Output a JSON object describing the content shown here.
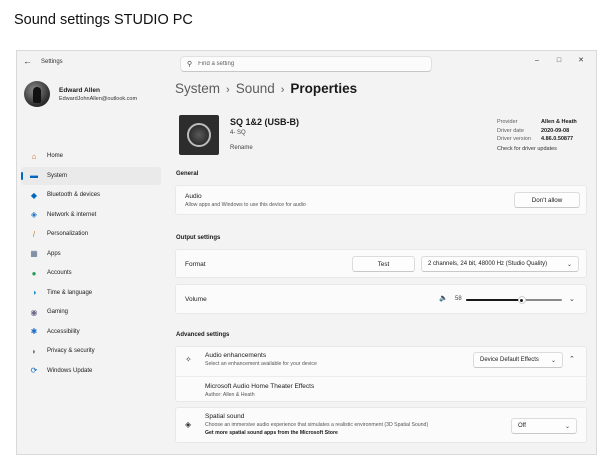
{
  "page_heading": "Sound settings STUDIO PC",
  "window": {
    "app_title": "Settings",
    "back_glyph": "←",
    "search_glyph": "⚲",
    "search_placeholder": "Find a setting",
    "controls": {
      "minimize": "–",
      "maximize": "□",
      "close": "✕"
    }
  },
  "profile": {
    "name": "Edward Allen",
    "email": "EdwardJohnAllen@outlook.com"
  },
  "nav": [
    {
      "label": "Home",
      "icon": "home-icon",
      "glyph": "⌂",
      "color": "#c96a2a",
      "active": false
    },
    {
      "label": "System",
      "icon": "monitor-icon",
      "glyph": "▬",
      "color": "#0067c0",
      "active": true
    },
    {
      "label": "Bluetooth & devices",
      "icon": "bluetooth-icon",
      "glyph": "◆",
      "color": "#0067c0",
      "active": false
    },
    {
      "label": "Network & internet",
      "icon": "wifi-icon",
      "glyph": "◈",
      "color": "#1a73c8",
      "active": false
    },
    {
      "label": "Personalization",
      "icon": "brush-icon",
      "glyph": "/",
      "color": "#c8782a",
      "active": false
    },
    {
      "label": "Apps",
      "icon": "apps-icon",
      "glyph": "▦",
      "color": "#5a6e8a",
      "active": false
    },
    {
      "label": "Accounts",
      "icon": "person-icon",
      "glyph": "●",
      "color": "#2a9a5a",
      "active": false
    },
    {
      "label": "Time & language",
      "icon": "globe-icon",
      "glyph": "◑",
      "color": "#1a8ac8",
      "active": false
    },
    {
      "label": "Gaming",
      "icon": "gamepad-icon",
      "glyph": "◉",
      "color": "#6a6a8a",
      "active": false
    },
    {
      "label": "Accessibility",
      "icon": "accessibility-icon",
      "glyph": "✱",
      "color": "#1a6ac8",
      "active": false
    },
    {
      "label": "Privacy & security",
      "icon": "shield-icon",
      "glyph": "◗",
      "color": "#6a6a7a",
      "active": false
    },
    {
      "label": "Windows Update",
      "icon": "update-icon",
      "glyph": "⟳",
      "color": "#0a6ac8",
      "active": false
    }
  ],
  "breadcrumb": {
    "part1": "System",
    "part2": "Sound",
    "current": "Properties",
    "sep": "›"
  },
  "device": {
    "name": "SQ 1&2 (USB-B)",
    "sub": "4- SQ",
    "rename": "Rename"
  },
  "driver": {
    "provider_label": "Provider",
    "provider": "Allen & Heath",
    "date_label": "Driver date",
    "date": "2020-09-08",
    "version_label": "Driver version",
    "version": "4.86.0.50877",
    "update_link": "Check for driver updates"
  },
  "sections": {
    "general": "General",
    "output": "Output settings",
    "advanced": "Advanced settings"
  },
  "audio": {
    "title": "Audio",
    "desc": "Allow apps and Windows to use this device for audio",
    "button": "Don't allow"
  },
  "format": {
    "title": "Format",
    "test_button": "Test",
    "value": "2 channels, 24 bit, 48000 Hz (Studio Quality)"
  },
  "volume": {
    "title": "Volume",
    "value": "58",
    "level": 58,
    "speaker_glyph": "🔈"
  },
  "enhancements": {
    "title": "Audio enhancements",
    "desc": "Select an enhancement available for your device",
    "value": "Device Default Effects",
    "effect_title": "Microsoft Audio Home Theater Effects",
    "effect_author": "Author: Allen & Heath"
  },
  "spatial": {
    "title": "Spatial sound",
    "desc": "Choose an immersive audio experience that simulates a realistic environment (3D Spatial Sound)",
    "link": "Get more spatial sound apps from the Microsoft Store",
    "value": "Off"
  },
  "glyphs": {
    "chev_down": "⌄",
    "chev_up": "⌃",
    "sparkle": "✧",
    "spatial": "◈"
  }
}
